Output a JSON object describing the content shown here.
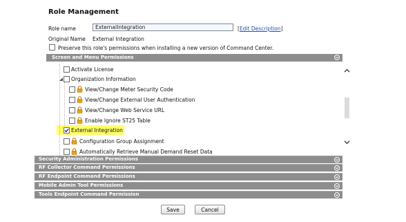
{
  "page": {
    "title": "Role Management"
  },
  "form": {
    "role_name_label": "Role name",
    "role_name_value": "ExternalIntegration",
    "edit_link_open": "[",
    "edit_link_label": "Edit Description",
    "edit_link_close": "]",
    "original_name_label": "Original Name",
    "original_name_value": "External Integration",
    "preserve_label": "Preserve this role's permissions when installing a new version of Command Center.",
    "preserve_checked": false
  },
  "permissions": {
    "header": "Screen and Menu Permissions",
    "items": [
      {
        "label": "Activate License",
        "checked": false,
        "locked": false
      },
      {
        "label": "Organization Information",
        "checked": false,
        "locked": false,
        "expanded": true
      },
      {
        "label": "View/Change Meter Security Code",
        "checked": false,
        "locked": true
      },
      {
        "label": "View/Change External User Authentication",
        "checked": false,
        "locked": true
      },
      {
        "label": "View/Change Web Service URL",
        "checked": false,
        "locked": true
      },
      {
        "label": "Enable Ignore ST25 Table",
        "checked": false,
        "locked": true
      },
      {
        "label": "External Integration",
        "checked": true,
        "locked": false,
        "highlighted": true
      },
      {
        "label": "Configuration Group Assignment",
        "checked": false,
        "locked": true
      },
      {
        "label": "Automatically Retrieve Manual Demand Reset Data",
        "checked": false,
        "locked": true
      }
    ]
  },
  "sections": [
    {
      "label": "Security Administration Permissions"
    },
    {
      "label": "RF Collector Command Permissions"
    },
    {
      "label": "RF Endpoint Command Permissions"
    },
    {
      "label": "Mobile Admin Tool Permissions"
    },
    {
      "label": "Tools Endpoint Command Permission"
    }
  ],
  "buttons": {
    "save": "Save",
    "cancel": "Cancel"
  },
  "colors": {
    "section_bar": "#8d8d8d",
    "highlight": "#ffff66",
    "link": "#1f4fb5",
    "lock": "#e8a317"
  },
  "icons": {
    "lock": "lock-icon",
    "collapse": "collapse-circle-icon",
    "checkmark": "checkmark-icon"
  }
}
